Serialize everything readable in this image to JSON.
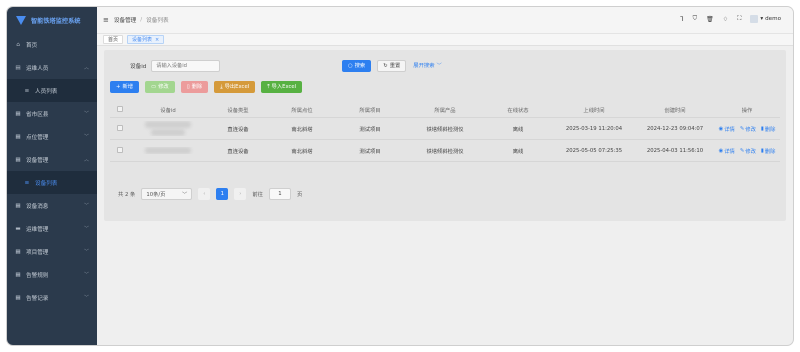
{
  "app": {
    "title": "智能铁塔监控系统"
  },
  "sidebar": {
    "items": [
      {
        "label": "首页",
        "icon": "home-icon"
      },
      {
        "label": "运维人员",
        "icon": "team-icon",
        "expanded": true
      },
      {
        "label": "人员列表",
        "icon": "list-icon",
        "sub": true
      },
      {
        "label": "省市区县",
        "icon": "region-icon"
      },
      {
        "label": "点位管理",
        "icon": "location-icon"
      },
      {
        "label": "设备管理",
        "icon": "device-icon",
        "expanded": true
      },
      {
        "label": "设备列表",
        "icon": "list-icon",
        "sub": true,
        "active": true
      },
      {
        "label": "设备消息",
        "icon": "message-icon"
      },
      {
        "label": "运维管理",
        "icon": "briefcase-icon"
      },
      {
        "label": "项目管理",
        "icon": "project-icon"
      },
      {
        "label": "告警规则",
        "icon": "rule-icon"
      },
      {
        "label": "告警记录",
        "icon": "record-icon"
      }
    ]
  },
  "header": {
    "breadcrumb": [
      "设备管理",
      "设备列表"
    ],
    "username": "demo"
  },
  "tabs": [
    {
      "label": "首页",
      "active": false
    },
    {
      "label": "设备列表",
      "active": true,
      "close": "×"
    }
  ],
  "search": {
    "label": "设备id",
    "placeholder": "请输入设备id",
    "search_btn": "搜索",
    "reset_btn": "重置",
    "expand_btn": "展开搜索"
  },
  "toolbar": {
    "add": "新增",
    "edit": "修改",
    "delete": "删除",
    "export": "导出Excel",
    "import": "导入Excel"
  },
  "table": {
    "headers": [
      "设备id",
      "设备类型",
      "所属点位",
      "所属项目",
      "所属产品",
      "在线状态",
      "上线时间",
      "创建时间",
      "操作"
    ],
    "rows": [
      {
        "type": "直连设备",
        "location": "南北斜塔",
        "project": "测试项目",
        "product": "铁塔倾斜检测仪",
        "status": "离线",
        "online_time": "2025-03-19 11:20:04",
        "created": "2024-12-23 09:04:07"
      },
      {
        "type": "直连设备",
        "location": "南北斜塔",
        "project": "测试项目",
        "product": "铁塔倾斜检测仪",
        "status": "离线",
        "online_time": "2025-05-05 07:25:35",
        "created": "2025-04-03 11:56:10"
      }
    ],
    "ops": {
      "detail": "详情",
      "edit": "修改",
      "delete": "删除"
    }
  },
  "pagination": {
    "total": "共 2 条",
    "page_size": "10条/页",
    "current": "1",
    "goto_label": "前往",
    "goto_value": "1",
    "page_unit": "页"
  },
  "colors": {
    "primary": "#2d7ff0",
    "sidebar": "#2b3a4c"
  }
}
